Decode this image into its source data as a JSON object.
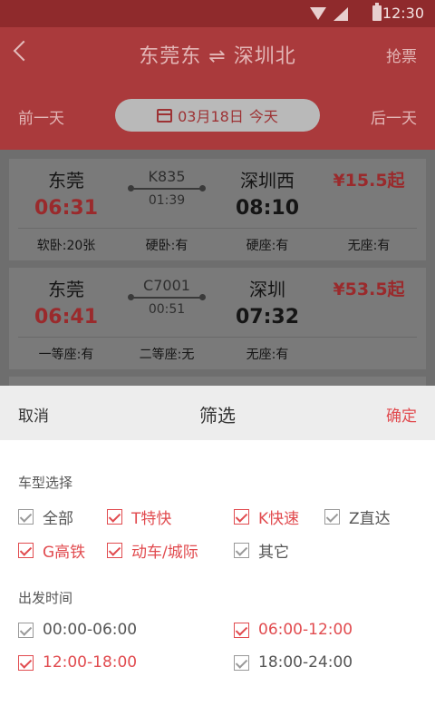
{
  "status_bar": {
    "time": "12:30"
  },
  "header": {
    "from_station": "东莞东",
    "swap_symbol": "⇌",
    "to_station": "深圳北",
    "grab_label": "抢票",
    "prev_day": "前一天",
    "next_day": "后一天",
    "date": "03月18日",
    "weekday": "今天"
  },
  "trains": [
    {
      "from": "东莞",
      "depart": "06:31",
      "train_no": "K835",
      "duration": "01:39",
      "to": "深圳西",
      "arrive": "08:10",
      "price": "¥15.5起",
      "seats": [
        "软卧:20张",
        "硬卧:有",
        "硬座:有",
        "无座:有"
      ]
    },
    {
      "from": "东莞",
      "depart": "06:41",
      "train_no": "C7001",
      "duration": "00:51",
      "to": "深圳",
      "arrive": "07:32",
      "price": "¥53.5起",
      "seats": [
        "一等座:有",
        "二等座:无",
        "无座:有"
      ]
    }
  ],
  "filter": {
    "cancel_label": "取消",
    "title": "筛选",
    "confirm_label": "确定",
    "train_type_title": "车型选择",
    "train_types": [
      {
        "label": "全部",
        "checked": false
      },
      {
        "label": "T特快",
        "checked": true
      },
      {
        "label": "K快速",
        "checked": true
      },
      {
        "label": "Z直达",
        "checked": false
      },
      {
        "label": "G高铁",
        "checked": true
      },
      {
        "label": "动车/城际",
        "checked": true
      },
      {
        "label": "其它",
        "checked": false
      }
    ],
    "depart_time_title": "出发时间",
    "depart_times": [
      {
        "label": "00:00-06:00",
        "checked": false
      },
      {
        "label": "06:00-12:00",
        "checked": true
      },
      {
        "label": "12:00-18:00",
        "checked": true
      },
      {
        "label": "18:00-24:00",
        "checked": false
      }
    ]
  },
  "colors": {
    "accent": "#e14b4f",
    "header_red": "#aa3a3c",
    "overlay_gray": "#6e6e6e"
  }
}
